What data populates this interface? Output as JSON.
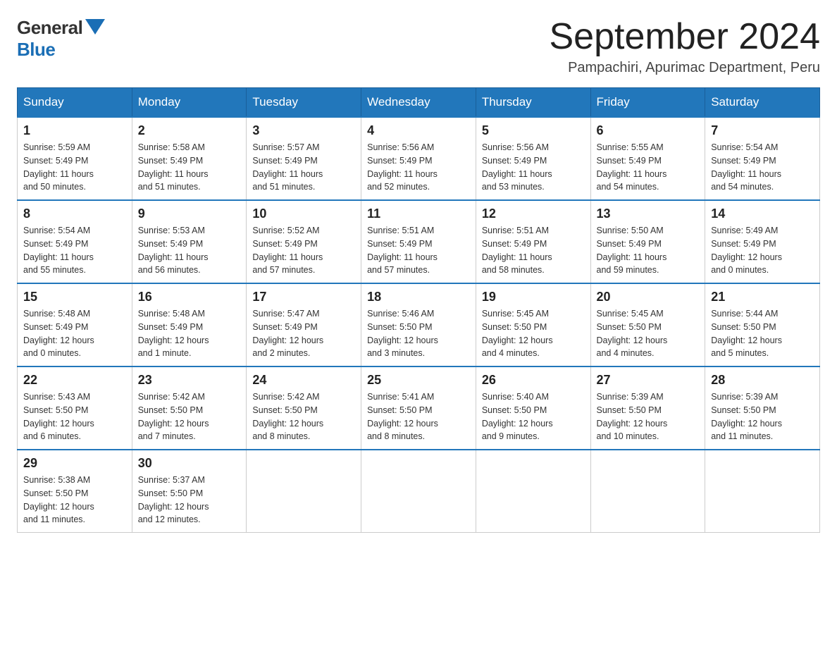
{
  "logo": {
    "general": "General",
    "blue": "Blue"
  },
  "title": {
    "month_year": "September 2024",
    "location": "Pampachiri, Apurimac Department, Peru"
  },
  "weekdays": [
    "Sunday",
    "Monday",
    "Tuesday",
    "Wednesday",
    "Thursday",
    "Friday",
    "Saturday"
  ],
  "weeks": [
    [
      {
        "day": "1",
        "sunrise": "5:59 AM",
        "sunset": "5:49 PM",
        "daylight": "11 hours and 50 minutes."
      },
      {
        "day": "2",
        "sunrise": "5:58 AM",
        "sunset": "5:49 PM",
        "daylight": "11 hours and 51 minutes."
      },
      {
        "day": "3",
        "sunrise": "5:57 AM",
        "sunset": "5:49 PM",
        "daylight": "11 hours and 51 minutes."
      },
      {
        "day": "4",
        "sunrise": "5:56 AM",
        "sunset": "5:49 PM",
        "daylight": "11 hours and 52 minutes."
      },
      {
        "day": "5",
        "sunrise": "5:56 AM",
        "sunset": "5:49 PM",
        "daylight": "11 hours and 53 minutes."
      },
      {
        "day": "6",
        "sunrise": "5:55 AM",
        "sunset": "5:49 PM",
        "daylight": "11 hours and 54 minutes."
      },
      {
        "day": "7",
        "sunrise": "5:54 AM",
        "sunset": "5:49 PM",
        "daylight": "11 hours and 54 minutes."
      }
    ],
    [
      {
        "day": "8",
        "sunrise": "5:54 AM",
        "sunset": "5:49 PM",
        "daylight": "11 hours and 55 minutes."
      },
      {
        "day": "9",
        "sunrise": "5:53 AM",
        "sunset": "5:49 PM",
        "daylight": "11 hours and 56 minutes."
      },
      {
        "day": "10",
        "sunrise": "5:52 AM",
        "sunset": "5:49 PM",
        "daylight": "11 hours and 57 minutes."
      },
      {
        "day": "11",
        "sunrise": "5:51 AM",
        "sunset": "5:49 PM",
        "daylight": "11 hours and 57 minutes."
      },
      {
        "day": "12",
        "sunrise": "5:51 AM",
        "sunset": "5:49 PM",
        "daylight": "11 hours and 58 minutes."
      },
      {
        "day": "13",
        "sunrise": "5:50 AM",
        "sunset": "5:49 PM",
        "daylight": "11 hours and 59 minutes."
      },
      {
        "day": "14",
        "sunrise": "5:49 AM",
        "sunset": "5:49 PM",
        "daylight": "12 hours and 0 minutes."
      }
    ],
    [
      {
        "day": "15",
        "sunrise": "5:48 AM",
        "sunset": "5:49 PM",
        "daylight": "12 hours and 0 minutes."
      },
      {
        "day": "16",
        "sunrise": "5:48 AM",
        "sunset": "5:49 PM",
        "daylight": "12 hours and 1 minute."
      },
      {
        "day": "17",
        "sunrise": "5:47 AM",
        "sunset": "5:49 PM",
        "daylight": "12 hours and 2 minutes."
      },
      {
        "day": "18",
        "sunrise": "5:46 AM",
        "sunset": "5:50 PM",
        "daylight": "12 hours and 3 minutes."
      },
      {
        "day": "19",
        "sunrise": "5:45 AM",
        "sunset": "5:50 PM",
        "daylight": "12 hours and 4 minutes."
      },
      {
        "day": "20",
        "sunrise": "5:45 AM",
        "sunset": "5:50 PM",
        "daylight": "12 hours and 4 minutes."
      },
      {
        "day": "21",
        "sunrise": "5:44 AM",
        "sunset": "5:50 PM",
        "daylight": "12 hours and 5 minutes."
      }
    ],
    [
      {
        "day": "22",
        "sunrise": "5:43 AM",
        "sunset": "5:50 PM",
        "daylight": "12 hours and 6 minutes."
      },
      {
        "day": "23",
        "sunrise": "5:42 AM",
        "sunset": "5:50 PM",
        "daylight": "12 hours and 7 minutes."
      },
      {
        "day": "24",
        "sunrise": "5:42 AM",
        "sunset": "5:50 PM",
        "daylight": "12 hours and 8 minutes."
      },
      {
        "day": "25",
        "sunrise": "5:41 AM",
        "sunset": "5:50 PM",
        "daylight": "12 hours and 8 minutes."
      },
      {
        "day": "26",
        "sunrise": "5:40 AM",
        "sunset": "5:50 PM",
        "daylight": "12 hours and 9 minutes."
      },
      {
        "day": "27",
        "sunrise": "5:39 AM",
        "sunset": "5:50 PM",
        "daylight": "12 hours and 10 minutes."
      },
      {
        "day": "28",
        "sunrise": "5:39 AM",
        "sunset": "5:50 PM",
        "daylight": "12 hours and 11 minutes."
      }
    ],
    [
      {
        "day": "29",
        "sunrise": "5:38 AM",
        "sunset": "5:50 PM",
        "daylight": "12 hours and 11 minutes."
      },
      {
        "day": "30",
        "sunrise": "5:37 AM",
        "sunset": "5:50 PM",
        "daylight": "12 hours and 12 minutes."
      },
      null,
      null,
      null,
      null,
      null
    ]
  ],
  "labels": {
    "sunrise": "Sunrise:",
    "sunset": "Sunset:",
    "daylight": "Daylight:"
  }
}
